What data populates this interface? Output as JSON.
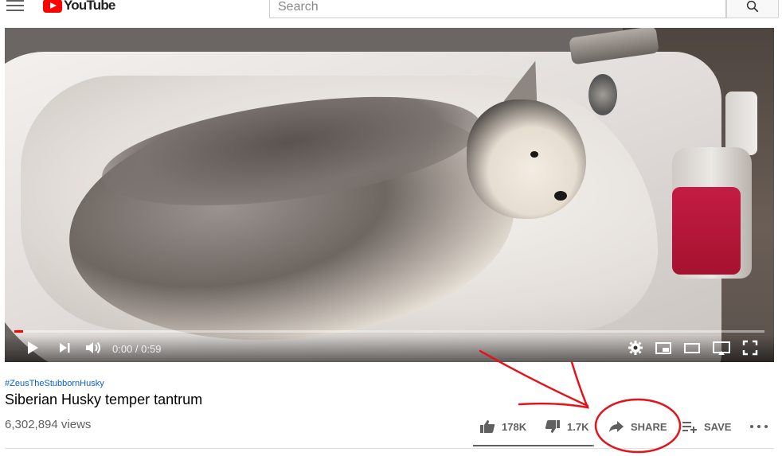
{
  "header": {
    "logo_text": "YouTube",
    "menu_icon": "hamburger-menu-icon",
    "search": {
      "placeholder": "Search",
      "value": "",
      "button_icon": "search-icon"
    }
  },
  "player": {
    "current_time": "0:00",
    "duration": "0:59",
    "time_display": "0:00 / 0:59",
    "progress_fraction": 0.012,
    "controls": [
      "play-icon",
      "next-icon",
      "volume-icon",
      "settings-icon",
      "miniplayer-icon",
      "theater-mode-icon",
      "cast-icon",
      "fullscreen-icon"
    ]
  },
  "video": {
    "hashtag": "#ZeusTheStubbornHusky",
    "title": "Siberian Husky temper tantrum",
    "views": "6,302,894 views"
  },
  "actions": {
    "likes": "178K",
    "dislikes": "1.7K",
    "share_label": "SHARE",
    "save_label": "SAVE",
    "like_fraction": 0.99
  },
  "colors": {
    "brand_red": "#ff0000",
    "link_blue": "#065fd4",
    "annotation_red": "#e3141b",
    "secondary_text": "#606060"
  }
}
